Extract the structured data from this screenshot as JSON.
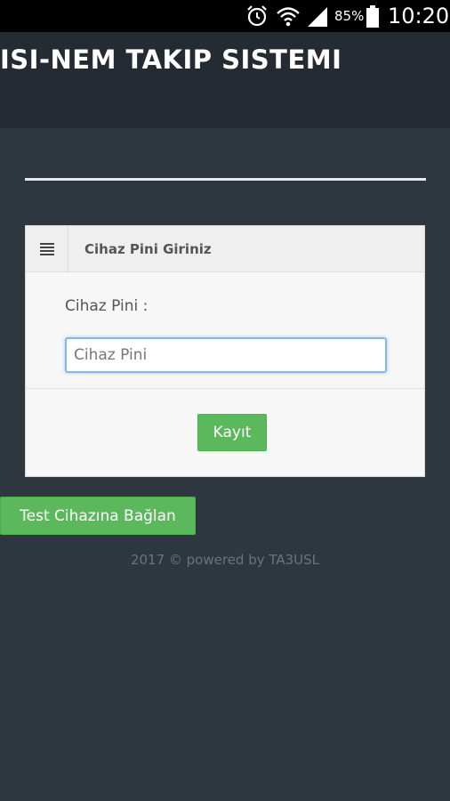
{
  "status_bar": {
    "battery_percent": "85%",
    "time": "10:20",
    "icons": [
      "alarm-icon",
      "wifi-icon",
      "signal-icon",
      "battery-icon"
    ]
  },
  "header": {
    "title": "ISI-NEM TAKIP SISTEMI"
  },
  "panel": {
    "title": "Cihaz Pini Giriniz",
    "menu_icon": "hamburger-menu-icon",
    "field_label": "Cihaz Pini :",
    "input_placeholder": "Cihaz Pini",
    "input_value": "",
    "submit_label": "Kayıt"
  },
  "test_button_label": "Test Cihazına Bağlan",
  "footer": "2017 © powered by TA3USL",
  "colors": {
    "background": "#2e363f",
    "header_background": "#242b33",
    "button_green": "#5cb85c",
    "input_focus": "#86b7e6"
  }
}
